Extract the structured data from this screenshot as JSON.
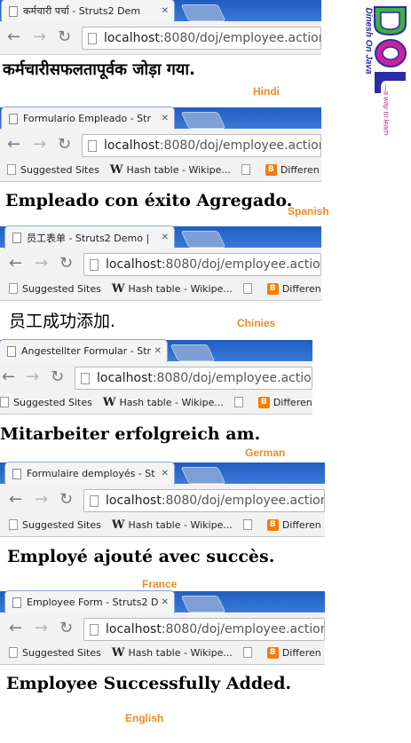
{
  "address_url": {
    "host": "localhost",
    "rest": ":8080/doj/employee.action"
  },
  "bookmarks": {
    "suggested": "Suggested Sites",
    "hash": "Hash table - Wikipe...",
    "diff": "Differen"
  },
  "logo": {
    "letters": "DOJ",
    "name": "Dinesh On Java",
    "tagline": "—a way to learn"
  },
  "colors": {
    "accent_orange": "#f08a24",
    "chrome_blue": "#1e5ec0",
    "logo_blue": "#2b2ba8",
    "logo_green": "#3fb13f",
    "logo_pink": "#cc2299"
  },
  "icons": [
    "back-arrow-icon",
    "forward-arrow-icon",
    "reload-icon",
    "page-icon",
    "close-icon",
    "wikipedia-icon",
    "blogger-icon"
  ],
  "sections": [
    {
      "tab_title": "कर्मचारी पर्चा - Struts2 Dem",
      "message": "कर्मचारीसफलतापूर्वक जोड़ा गया.",
      "language": "Hindi"
    },
    {
      "tab_title": "Formulario Empleado - Str",
      "message": "Empleado con éxito Agregado.",
      "language": "Spanish"
    },
    {
      "tab_title": "员工表单 - Struts2 Demo |",
      "message": "员工成功添加.",
      "language": "Chinies"
    },
    {
      "tab_title": "Angestellter Formular - Str",
      "message": "Mitarbeiter erfolgreich am.",
      "language": "German"
    },
    {
      "tab_title": "Formulaire demployés - St",
      "message": "Employé ajouté avec succès.",
      "language": "France"
    },
    {
      "tab_title": "Employee Form - Struts2 D",
      "message": "Employee Successfully Added.",
      "language": "English"
    }
  ]
}
